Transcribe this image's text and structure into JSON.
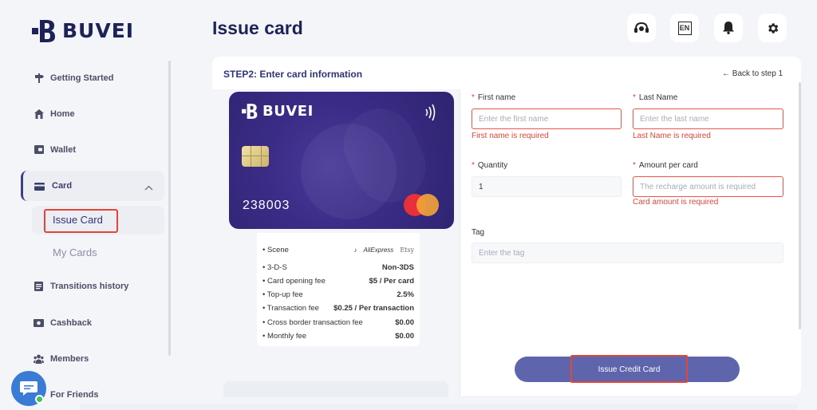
{
  "brand": {
    "name": "BUVEI"
  },
  "header": {
    "title": "Issue card",
    "language": "EN",
    "icons": [
      "support-icon",
      "language-icon",
      "bell-icon",
      "gear-icon"
    ]
  },
  "sidebar": {
    "items": [
      {
        "label": "Getting Started",
        "icon": "signpost-icon"
      },
      {
        "label": "Home",
        "icon": "home-icon"
      },
      {
        "label": "Wallet",
        "icon": "wallet-icon"
      },
      {
        "label": "Card",
        "icon": "card-icon"
      },
      {
        "label": "Transitions history",
        "icon": "list-icon"
      },
      {
        "label": "Cashback",
        "icon": "cashback-icon"
      },
      {
        "label": "Members",
        "icon": "members-icon"
      },
      {
        "label": "For Friends",
        "icon": "friends-icon"
      }
    ],
    "card_sub": {
      "issue": "Issue Card",
      "my_cards": "My Cards"
    }
  },
  "step": {
    "title": "STEP2: Enter card information",
    "back": "← Back to step 1"
  },
  "card_preview": {
    "brand": "BUVEI",
    "number": "238003",
    "network": "mastercard"
  },
  "card_info": {
    "scene_label": "Scene",
    "scene_logos": [
      "TikTok",
      "AliExpress",
      "Etsy"
    ],
    "rows": [
      {
        "label": "3-D-S",
        "value": "Non-3DS"
      },
      {
        "label": "Card opening fee",
        "value": "$5 / Per card"
      },
      {
        "label": "Top-up fee",
        "value": "2.5%"
      },
      {
        "label": "Transaction fee",
        "value": "$0.25 / Per transaction"
      },
      {
        "label": "Cross border transaction fee",
        "value": "$0.00"
      },
      {
        "label": "Monthly fee",
        "value": "$0.00"
      }
    ]
  },
  "form": {
    "first_name": {
      "label": "First name",
      "placeholder": "Enter the first name",
      "error": "First name is required"
    },
    "last_name": {
      "label": "Last Name",
      "placeholder": "Enter the last name",
      "error": "Last Name is required"
    },
    "quantity": {
      "label": "Quantity",
      "value": "1"
    },
    "amount": {
      "label": "Amount per card",
      "placeholder": "The recharge amount is required",
      "error": "Card amount is required"
    },
    "tag": {
      "label": "Tag",
      "placeholder": "Enter the tag"
    },
    "submit": "Issue Credit Card"
  },
  "colors": {
    "brand_navy": "#1d2257",
    "accent": "#5e65ad",
    "error": "#e0463a",
    "card_purple": "#3b2d88"
  }
}
